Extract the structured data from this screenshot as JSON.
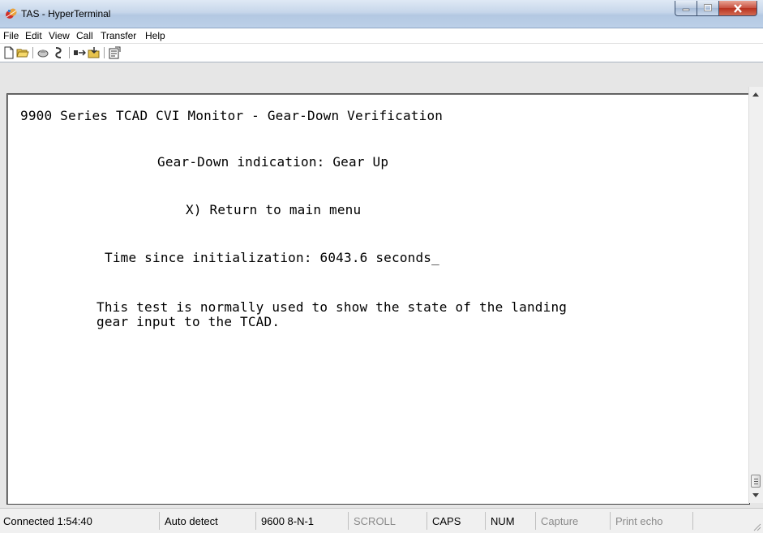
{
  "window": {
    "title": "TAS - HyperTerminal",
    "icon": "hyperterminal-icon",
    "controls": [
      "minimize-icon",
      "maximize-icon",
      "close-icon"
    ]
  },
  "menu": [
    "File",
    "Edit",
    "View",
    "Call",
    "Transfer",
    "Help"
  ],
  "toolbar": [
    "new-icon",
    "open-icon",
    "disconnect-icon",
    "connect-icon",
    "send-icon",
    "receive-icon",
    "properties-icon"
  ],
  "terminal": {
    "lines": [
      "9900 Series TCAD CVI Monitor - Gear-Down Verification",
      "Gear-Down indication: Gear Up",
      "X) Return to main menu",
      "Time since initialization: 6043.6 seconds_",
      "This test is normally used to show the state of the landing",
      "gear input to the TCAD."
    ]
  },
  "status": {
    "connected": "Connected 1:54:40",
    "detect": "Auto detect",
    "settings": "9600 8-N-1",
    "scroll": "SCROLL",
    "caps": "CAPS",
    "num": "NUM",
    "capture": "Capture",
    "print_echo": "Print echo"
  }
}
